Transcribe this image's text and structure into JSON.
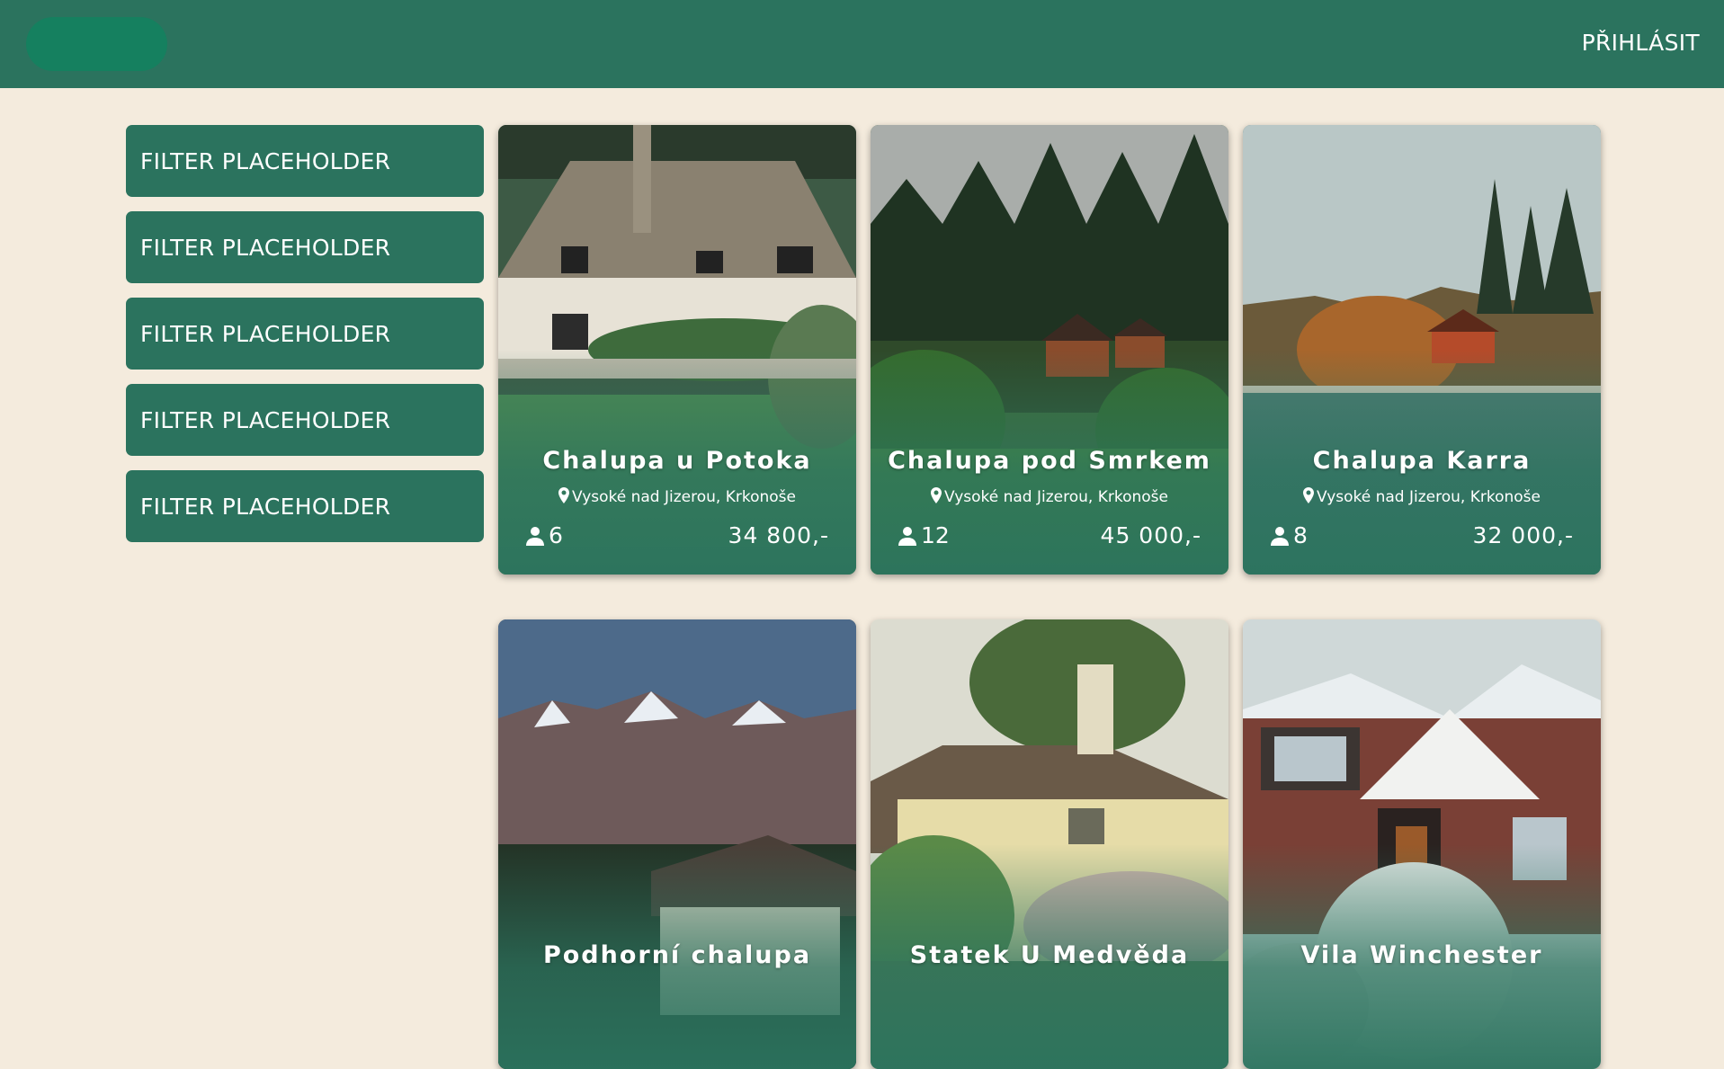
{
  "header": {
    "login_label": "PŘIHLÁSIT"
  },
  "filters": [
    "FILTER PLACEHOLDER",
    "FILTER PLACEHOLDER",
    "FILTER PLACEHOLDER",
    "FILTER PLACEHOLDER",
    "FILTER PLACEHOLDER"
  ],
  "cards": [
    {
      "title": "Chalupa u Potoka",
      "location": "Vysoké nad Jizerou, Krkonoše",
      "capacity": "6",
      "price": "34 800,-"
    },
    {
      "title": "Chalupa pod Smrkem",
      "location": "Vysoké nad Jizerou, Krkonoše",
      "capacity": "12",
      "price": "45 000,-"
    },
    {
      "title": "Chalupa Karra",
      "location": "Vysoké nad Jizerou, Krkonoše",
      "capacity": "8",
      "price": "32 000,-"
    },
    {
      "title": "Podhorní chalupa"
    },
    {
      "title": "Statek U Medvěda"
    },
    {
      "title": "Vila Winchester"
    }
  ],
  "colors": {
    "primary": "#2b735e",
    "logo": "#15805f",
    "background": "#f4ebdd"
  },
  "icons": {
    "location": "map-pin-icon",
    "capacity": "person-icon"
  }
}
